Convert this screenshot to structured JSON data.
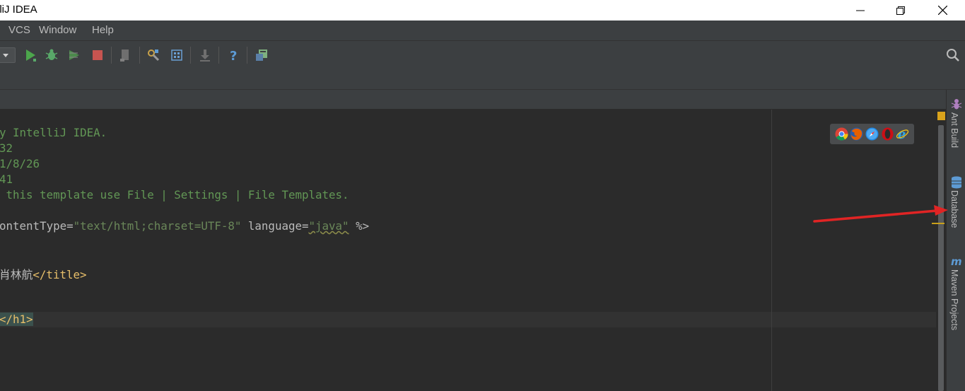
{
  "window": {
    "title": "lliJ IDEA",
    "controls": [
      "minimize",
      "maximize",
      "close"
    ]
  },
  "menu": {
    "items": [
      {
        "label": "VCS"
      },
      {
        "label": "Window"
      },
      {
        "label": "Help"
      }
    ]
  },
  "toolbar": {
    "icons": [
      "dropdown-arrow-icon",
      "run-icon",
      "debug-icon",
      "coverage-icon",
      "stop-icon",
      "build-artifact-icon",
      "project-structure-icon",
      "sdk-icon",
      "vcs-update-icon",
      "help-icon",
      "sdk-manager-icon",
      "search-everywhere-icon"
    ]
  },
  "editor": {
    "lines": [
      {
        "parts": [
          {
            "t": "y IntelliJ IDEA.",
            "c": "cm"
          }
        ]
      },
      {
        "parts": [
          {
            "t": "32",
            "c": "cm"
          }
        ]
      },
      {
        "parts": [
          {
            "t": "1/8/26",
            "c": "cm"
          }
        ]
      },
      {
        "parts": [
          {
            "t": "41",
            "c": "cm"
          }
        ]
      },
      {
        "parts": [
          {
            "t": " this template use File | Settings | File Templates.",
            "c": "cm"
          }
        ]
      },
      {
        "parts": [
          {
            "t": "ontentType=",
            "c": "attr"
          },
          {
            "t": "\"text/html;charset=UTF-8\"",
            "c": "str"
          },
          {
            "t": " language=",
            "c": "attr"
          },
          {
            "t": "\"java\"",
            "c": "str wavy"
          },
          {
            "t": " %>",
            "c": "attr"
          }
        ]
      },
      {
        "parts": [
          {
            "t": "肖林航",
            "c": "attr"
          },
          {
            "t": "</title>",
            "c": "tag"
          }
        ]
      },
      {
        "parts": [
          {
            "t": "</h1>",
            "c": "tag h1close"
          }
        ]
      }
    ]
  },
  "browsers": [
    "chrome-icon",
    "firefox-icon",
    "safari-icon",
    "opera-icon",
    "ie-icon"
  ],
  "tool_windows": [
    {
      "label": "Ant Build"
    },
    {
      "label": "Database"
    },
    {
      "label": "Maven Projects"
    }
  ],
  "colors": {
    "background": "#2b2b2b",
    "chrome": "#3c3f41",
    "comment": "#629755",
    "tag": "#e8bf6a",
    "string": "#6a8759",
    "arrow": "#e02424"
  }
}
